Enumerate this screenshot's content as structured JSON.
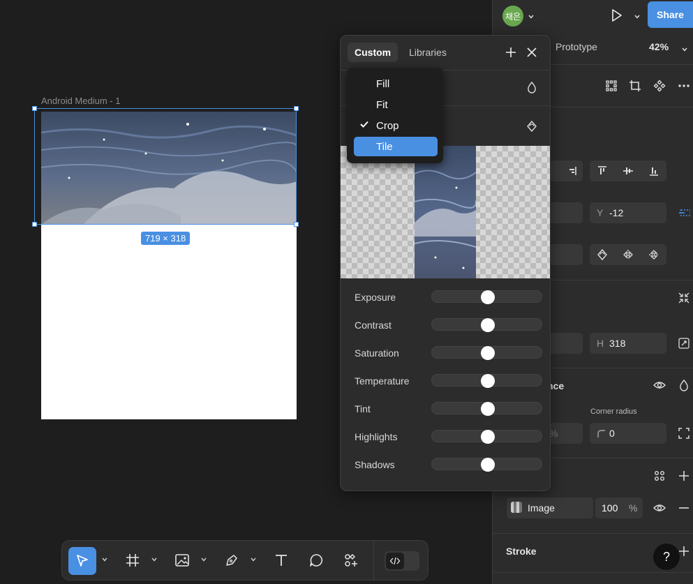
{
  "canvas": {
    "frame_label": "Android Medium - 1",
    "dimensions_badge": "719 × 318"
  },
  "header": {
    "avatar_text": "채은",
    "share_label": "Share",
    "prototype_tab": "Prototype",
    "zoom": "42%"
  },
  "popup": {
    "tabs": [
      {
        "label": "Custom",
        "active": true
      },
      {
        "label": "Libraries",
        "active": false
      }
    ],
    "adjustments": [
      {
        "label": "Exposure",
        "value": 0.5
      },
      {
        "label": "Contrast",
        "value": 0.5
      },
      {
        "label": "Saturation",
        "value": 0.5
      },
      {
        "label": "Temperature",
        "value": 0.5
      },
      {
        "label": "Tint",
        "value": 0.5
      },
      {
        "label": "Highlights",
        "value": 0.5
      },
      {
        "label": "Shadows",
        "value": 0.5
      }
    ]
  },
  "dropdown": {
    "items": [
      {
        "label": "Fill",
        "checked": false,
        "highlighted": false
      },
      {
        "label": "Fit",
        "checked": false,
        "highlighted": false
      },
      {
        "label": "Crop",
        "checked": true,
        "highlighted": false
      },
      {
        "label": "Tile",
        "checked": false,
        "highlighted": true
      }
    ]
  },
  "properties": {
    "y_label": "Y",
    "y_value": "-12",
    "h_label": "H",
    "h_value": "318",
    "appearance_partial": "nce",
    "corner_radius_label": "Corner radius",
    "corner_radius_value": "0",
    "partial_s": "s",
    "percent_partial": "%",
    "fill_type": "Image",
    "fill_opacity": "100",
    "fill_opacity_unit": "%",
    "stroke_label": "Stroke",
    "help": "?"
  },
  "colors": {
    "accent": "#4a90e2",
    "avatar_bg": "#6aa84f",
    "panel_bg": "#2c2c2c",
    "canvas_bg": "#1e1e1e"
  }
}
